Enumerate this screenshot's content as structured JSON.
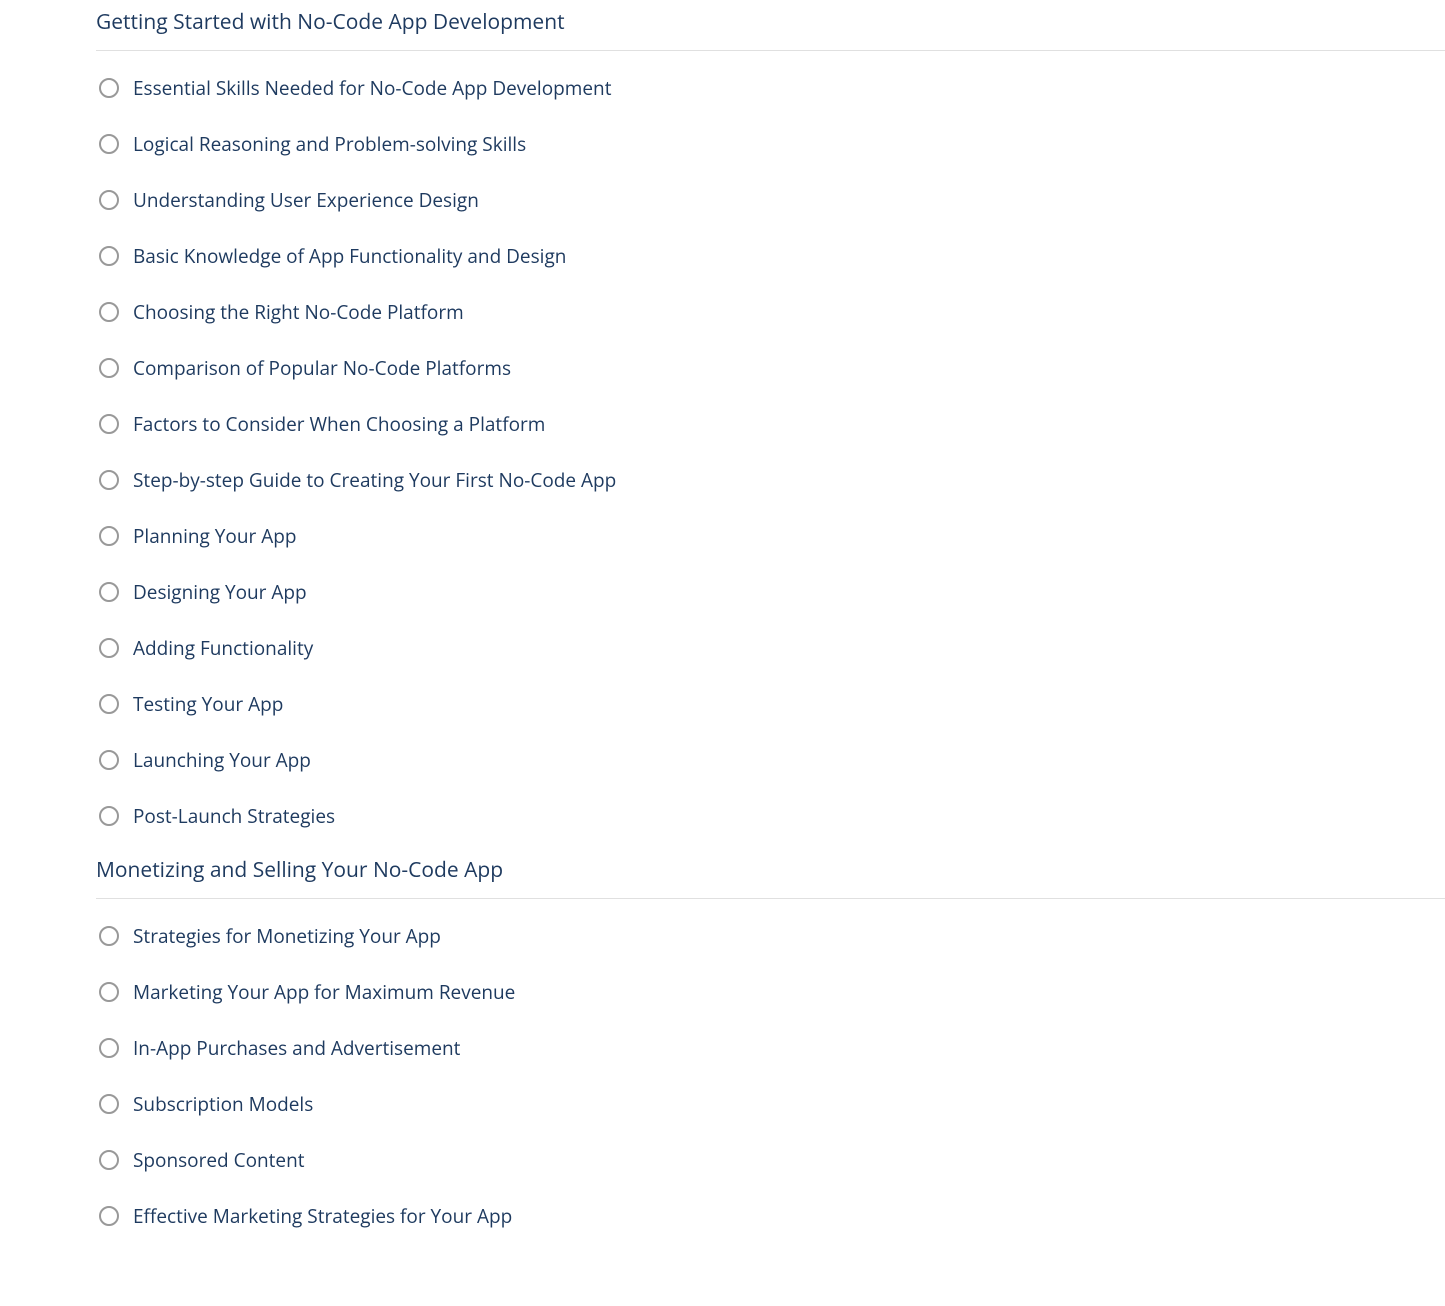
{
  "sections": [
    {
      "title": "Getting Started with No-Code App Development",
      "items": [
        "Essential Skills Needed for No-Code App Development",
        "Logical Reasoning and Problem-solving Skills",
        "Understanding User Experience Design",
        "Basic Knowledge of App Functionality and Design",
        "Choosing the Right No-Code Platform",
        "Comparison of Popular No-Code Platforms",
        "Factors to Consider When Choosing a Platform",
        "Step-by-step Guide to Creating Your First No-Code App",
        "Planning Your App",
        "Designing Your App",
        "Adding Functionality",
        "Testing Your App",
        "Launching Your App",
        "Post-Launch Strategies"
      ]
    },
    {
      "title": "Monetizing and Selling Your No-Code App",
      "items": [
        "Strategies for Monetizing Your App",
        "Marketing Your App for Maximum Revenue",
        "In-App Purchases and Advertisement",
        "Subscription Models",
        "Sponsored Content",
        "Effective Marketing Strategies for Your App"
      ]
    }
  ]
}
